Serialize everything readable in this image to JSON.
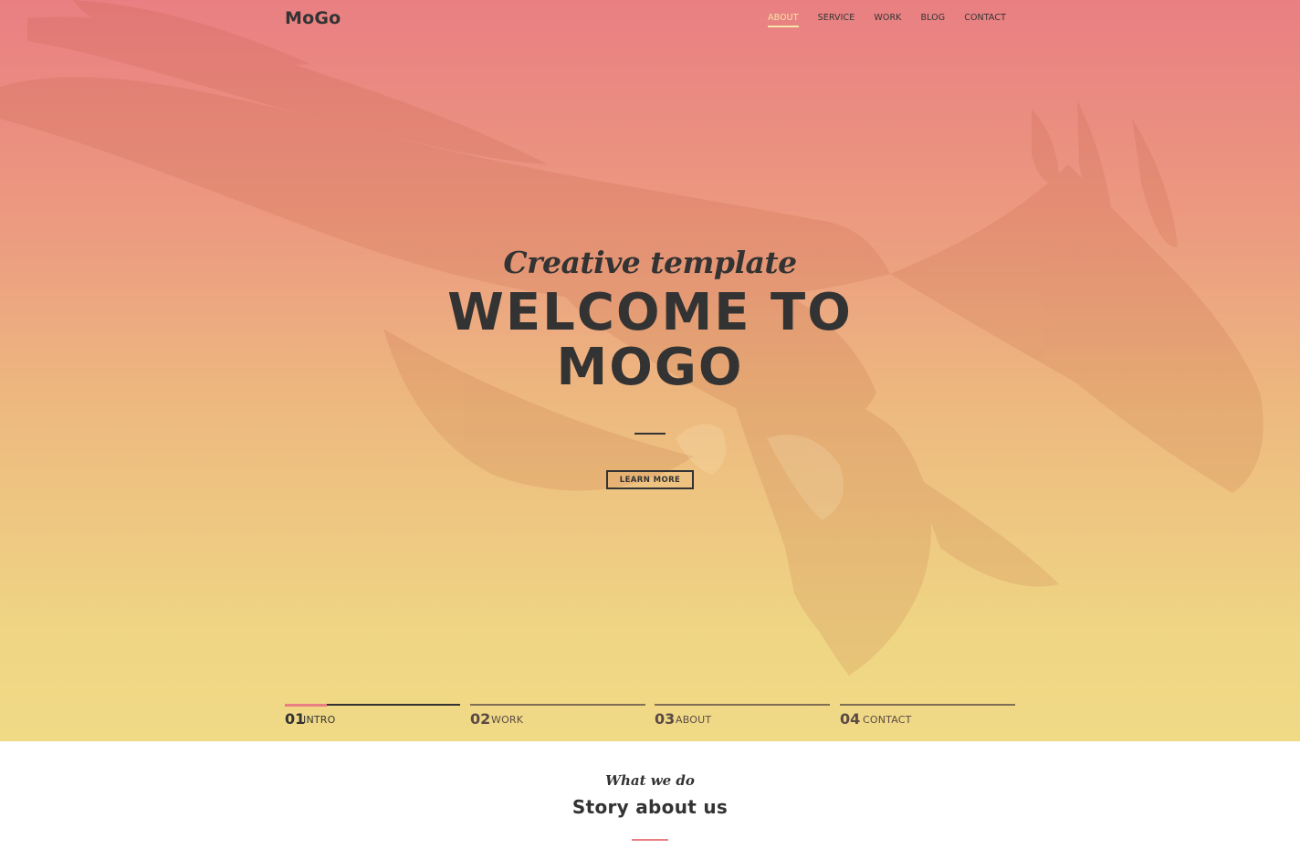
{
  "header": {
    "logo": "MoGo",
    "nav": [
      {
        "label": "ABOUT",
        "active": true
      },
      {
        "label": "SERVICE",
        "active": false
      },
      {
        "label": "WORK",
        "active": false
      },
      {
        "label": "BLOG",
        "active": false
      },
      {
        "label": "CONTACT",
        "active": false
      }
    ]
  },
  "hero": {
    "script_title": "Creative template",
    "headline_line1": "WELCOME TO",
    "headline_line2": "MOGO",
    "button_label": "LEARN MORE",
    "background_image": "eagle-in-flight"
  },
  "slider": [
    {
      "number": "01",
      "label": "INTRO",
      "active": true,
      "progress": 0.24
    },
    {
      "number": "02",
      "label": "WORK",
      "active": false,
      "progress": 0
    },
    {
      "number": "03",
      "label": "ABOUT",
      "active": false,
      "progress": 0
    },
    {
      "number": "04",
      "label": "CONTACT",
      "active": false,
      "progress": 0
    }
  ],
  "story": {
    "script_title": "What we do",
    "title": "Story about us"
  },
  "colors": {
    "gradient_top": "#e97f82",
    "gradient_bottom": "#f0da86",
    "accent": "#e97f82",
    "nav_active": "#f6e5a8",
    "text": "#333333"
  }
}
